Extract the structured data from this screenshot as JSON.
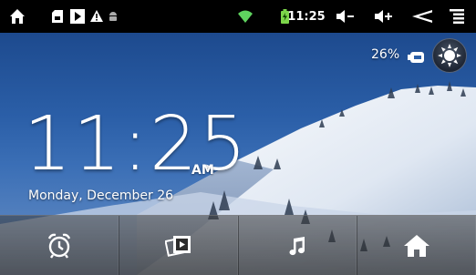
{
  "status_bar": {
    "time": "11:25",
    "icons": [
      "home-icon",
      "sd-card-icon",
      "media-play-icon",
      "warning-icon",
      "android-debug-icon",
      "wifi-icon",
      "battery-charging-icon",
      "volume-down-icon",
      "volume-up-icon",
      "back-icon",
      "menu-icon"
    ]
  },
  "battery_widget": {
    "percent": "26%",
    "icon": "battery-icon",
    "brightness_icon": "brightness-icon"
  },
  "clock_widget": {
    "time": "11:25",
    "ampm": "AM",
    "date": "Monday, December 26"
  },
  "dock": {
    "items": [
      {
        "icon": "alarm-clock-icon"
      },
      {
        "icon": "gallery-icon"
      },
      {
        "icon": "music-icon"
      },
      {
        "icon": "home-icon"
      }
    ]
  },
  "colors": {
    "status_bar_bg": "#000000",
    "wifi_green": "#5fd35f",
    "battery_green": "#7cd64a",
    "sky_top": "#1d4a8e"
  }
}
